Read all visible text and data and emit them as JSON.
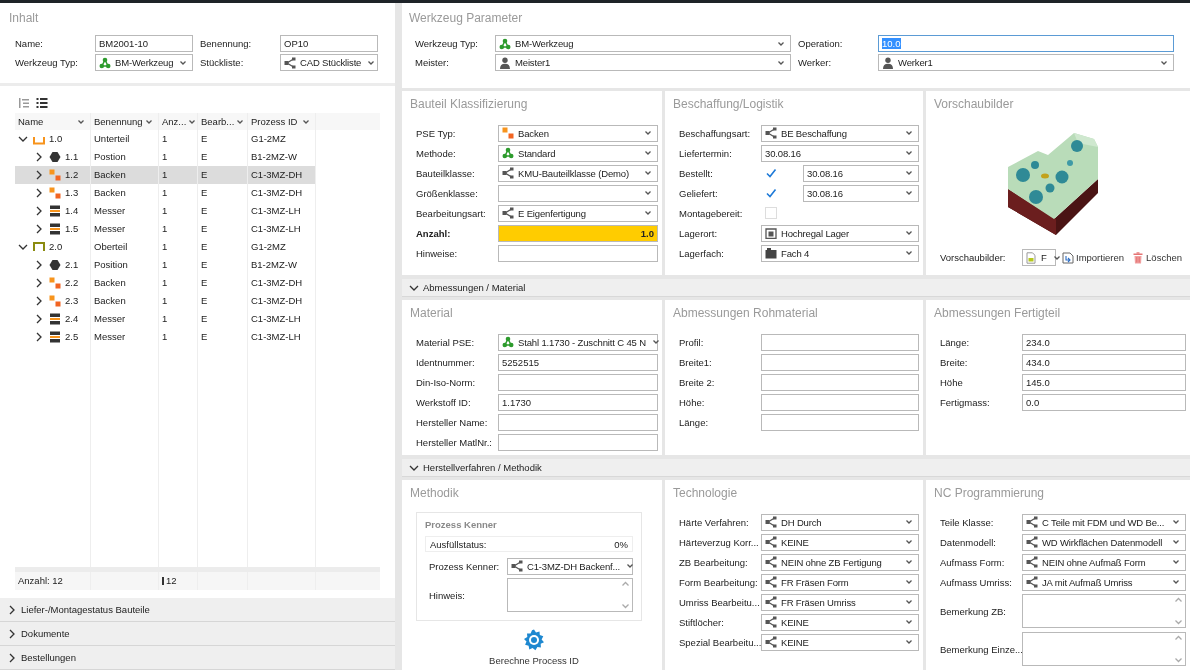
{
  "left": {
    "title": "Inhalt",
    "fields": [
      {
        "label": "Name:",
        "value": "BM2001-10",
        "kind": "text"
      },
      {
        "label": "Benennung:",
        "value": "OP10",
        "kind": "text"
      },
      {
        "label": "Werkzeug Typ:",
        "value": "BM-Werkzeug",
        "kind": "select-tool"
      },
      {
        "label": "Stückliste:",
        "value": "CAD Stückliste",
        "kind": "select-class"
      }
    ],
    "tree": {
      "columns": [
        "Name",
        "Benennung",
        "Anz...",
        "Bearb...",
        "Prozess ID"
      ],
      "rows": [
        {
          "kind": "unterteil",
          "expanded": true,
          "selected": false,
          "cells": [
            "1.0",
            "Unterteil",
            "1",
            "E",
            "G1-2MZ"
          ],
          "children": [
            {
              "kind": "position",
              "expanded": false,
              "selected": false,
              "cells": [
                "1.1",
                "Postion",
                "1",
                "E",
                "B1-2MZ-W"
              ]
            },
            {
              "kind": "backen",
              "expanded": false,
              "selected": true,
              "cells": [
                "1.2",
                "Backen",
                "1",
                "E",
                "C1-3MZ-DH"
              ]
            },
            {
              "kind": "backen",
              "expanded": false,
              "selected": false,
              "cells": [
                "1.3",
                "Backen",
                "1",
                "E",
                "C1-3MZ-DH"
              ]
            },
            {
              "kind": "messer",
              "expanded": false,
              "selected": false,
              "cells": [
                "1.4",
                "Messer",
                "1",
                "E",
                "C1-3MZ-LH"
              ]
            },
            {
              "kind": "messer",
              "expanded": false,
              "selected": false,
              "cells": [
                "1.5",
                "Messer",
                "1",
                "E",
                "C1-3MZ-LH"
              ]
            }
          ]
        },
        {
          "kind": "oberteil",
          "expanded": true,
          "selected": false,
          "cells": [
            "2.0",
            "Oberteil",
            "1",
            "E",
            "G1-2MZ"
          ],
          "children": [
            {
              "kind": "position",
              "expanded": false,
              "selected": false,
              "cells": [
                "2.1",
                "Position",
                "1",
                "E",
                "B1-2MZ-W"
              ]
            },
            {
              "kind": "backen",
              "expanded": false,
              "selected": false,
              "cells": [
                "2.2",
                "Backen",
                "1",
                "E",
                "C1-3MZ-DH"
              ]
            },
            {
              "kind": "backen",
              "expanded": false,
              "selected": false,
              "cells": [
                "2.3",
                "Backen",
                "1",
                "E",
                "C1-3MZ-DH"
              ]
            },
            {
              "kind": "messer",
              "expanded": false,
              "selected": false,
              "cells": [
                "2.4",
                "Messer",
                "1",
                "E",
                "C1-3MZ-LH"
              ]
            },
            {
              "kind": "messer",
              "expanded": false,
              "selected": false,
              "cells": [
                "2.5",
                "Messer",
                "1",
                "E",
                "C1-3MZ-LH"
              ]
            }
          ]
        }
      ],
      "footer": {
        "label": "Anzahl: 12",
        "sum": "12"
      }
    },
    "collapsibles": [
      {
        "label": "Liefer-/Montagestatus Bauteile",
        "expanded": false
      },
      {
        "label": "Dokumente",
        "expanded": false
      },
      {
        "label": "Bestellungen",
        "expanded": false
      }
    ]
  },
  "right": {
    "params": {
      "title": "Werkzeug Parameter",
      "fields": [
        {
          "label": "Werkzeug Typ:",
          "value": "BM-Werkzeug",
          "kind": "select-tool"
        },
        {
          "label": "Operation:",
          "value": "10.0",
          "kind": "text",
          "focused": true
        },
        {
          "label": "Meister:",
          "value": "Meister1",
          "kind": "select-person"
        },
        {
          "label": "Werker:",
          "value": "Werker1",
          "kind": "select-person"
        }
      ]
    },
    "sections": [
      {
        "panels": [
          {
            "kind": "form",
            "title": "Bauteil Klassifizierung",
            "fields": [
              {
                "label": "PSE Typ:",
                "value": "Backen",
                "kind": "select-part"
              },
              {
                "label": "Methode:",
                "value": "Standard",
                "kind": "select-tool"
              },
              {
                "label": "Bauteilklasse:",
                "value": "KMU-Bauteilklasse (Demo)",
                "kind": "select-class"
              },
              {
                "label": "Größenklasse:",
                "kind": "select"
              },
              {
                "label": "Bearbeitungsart:",
                "value": "E Eigenfertigung",
                "kind": "select-class"
              },
              {
                "label": "Anzahl:",
                "value": "1.0",
                "kind": "required"
              },
              {
                "label": "Hinweise:",
                "kind": "text"
              }
            ]
          },
          {
            "kind": "form",
            "title": "Beschaffung/Logistik",
            "fields": [
              {
                "label": "Beschaffungsart:",
                "value": "BE Beschaffung",
                "kind": "select-class"
              },
              {
                "label": "Liefertermin:",
                "value": "30.08.16",
                "kind": "select"
              },
              {
                "label": "Bestellt:",
                "value": "30.08.16",
                "kind": "check-date",
                "checked": true
              },
              {
                "label": "Geliefert:",
                "value": "30.08.16",
                "kind": "check-date",
                "checked": true
              },
              {
                "label": "Montagebereit:",
                "kind": "check",
                "checked": false
              },
              {
                "label": "Lagerort:",
                "value": "Hochregal Lager",
                "kind": "select-storage"
              },
              {
                "label": "Lagerfach:",
                "value": "Fach 4",
                "kind": "select-bin"
              }
            ]
          },
          {
            "kind": "preview",
            "title": "Vorschaubilder",
            "label": "Vorschaubilder:",
            "file": "F",
            "actions": [
              {
                "kind": "import",
                "label": "Importieren"
              },
              {
                "kind": "delete",
                "label": "Löschen"
              }
            ]
          }
        ]
      },
      {
        "title": "Abmessungen / Material",
        "expanded": true,
        "panels": [
          {
            "kind": "form",
            "title": "Material",
            "fields": [
              {
                "label": "Material PSE:",
                "value": "Stahl 1.1730 - Zuschnitt C 45 N",
                "kind": "select-tool"
              },
              {
                "label": "Identnummer:",
                "value": "5252515",
                "kind": "text"
              },
              {
                "label": "Din-Iso-Norm:",
                "kind": "text"
              },
              {
                "label": "Werkstoff ID:",
                "value": "1.1730",
                "kind": "text"
              },
              {
                "label": "Hersteller Name:",
                "kind": "text"
              },
              {
                "label": "Hersteller MatlNr.:",
                "kind": "text"
              }
            ]
          },
          {
            "kind": "form",
            "title": "Abmessungen Rohmaterial",
            "fields": [
              {
                "label": "Profil:",
                "kind": "text"
              },
              {
                "label": "Breite1:",
                "kind": "text"
              },
              {
                "label": "Breite 2:",
                "kind": "text"
              },
              {
                "label": "Höhe:",
                "kind": "text"
              },
              {
                "label": "Länge:",
                "kind": "text"
              }
            ]
          },
          {
            "kind": "form",
            "title": "Abmessungen Fertigteil",
            "fields": [
              {
                "label": "Länge:",
                "value": "234.0",
                "kind": "text"
              },
              {
                "label": "Breite:",
                "value": "434.0",
                "kind": "text"
              },
              {
                "label": "Höhe",
                "value": "145.0",
                "kind": "text"
              },
              {
                "label": "Fertigmass:",
                "value": "0.0",
                "kind": "text"
              }
            ]
          }
        ]
      },
      {
        "title": "Herstellverfahren / Methodik",
        "expanded": true,
        "panels": [
          {
            "kind": "methodik",
            "title": "Methodik",
            "box_title": "Prozess Kenner",
            "status": {
              "label": "Ausfüllstatus:",
              "value": "0%"
            },
            "fields": [
              {
                "label": "Prozess Kenner:",
                "value": "C1-3MZ-DH Backenf...",
                "kind": "select-class"
              },
              {
                "label": "Hinweis:",
                "kind": "area"
              }
            ],
            "action": "Berechne Process ID"
          },
          {
            "kind": "form",
            "title": "Technologie",
            "fields": [
              {
                "label": "Härte Verfahren:",
                "value": "DH Durch",
                "kind": "select-class"
              },
              {
                "label": "Härteverzug Korr...",
                "value": "KEINE",
                "kind": "select-class"
              },
              {
                "label": "ZB Bearbeitung:",
                "value": "NEIN ohne ZB Fertigung",
                "kind": "select-class"
              },
              {
                "label": "Form Bearbeitung:",
                "value": "FR Fräsen Form",
                "kind": "select-class"
              },
              {
                "label": "Umriss Bearbeitu...",
                "value": "FR Fräsen Umriss",
                "kind": "select-class"
              },
              {
                "label": "Stiftlöcher:",
                "value": "KEINE",
                "kind": "select-class"
              },
              {
                "label": "Spezial Bearbeitu...",
                "value": "KEINE",
                "kind": "select-class"
              }
            ]
          },
          {
            "kind": "form",
            "title": "NC Programmierung",
            "fields": [
              {
                "label": "Teile Klasse:",
                "value": "C Teile mit FDM und WD Be...",
                "kind": "select-class"
              },
              {
                "label": "Datenmodell:",
                "value": "WD Wirkflächen Datenmodell",
                "kind": "select-class"
              },
              {
                "label": "Aufmass Form:",
                "value": "NEIN ohne Aufmaß Form",
                "kind": "select-class"
              },
              {
                "label": "Aufmass Umriss:",
                "value": "JA mit Aufmaß Umriss",
                "kind": "select-class"
              },
              {
                "label": "Bemerkung ZB:",
                "kind": "area"
              },
              {
                "label": "Bemerkung Einze...",
                "kind": "area"
              }
            ]
          }
        ]
      }
    ]
  }
}
